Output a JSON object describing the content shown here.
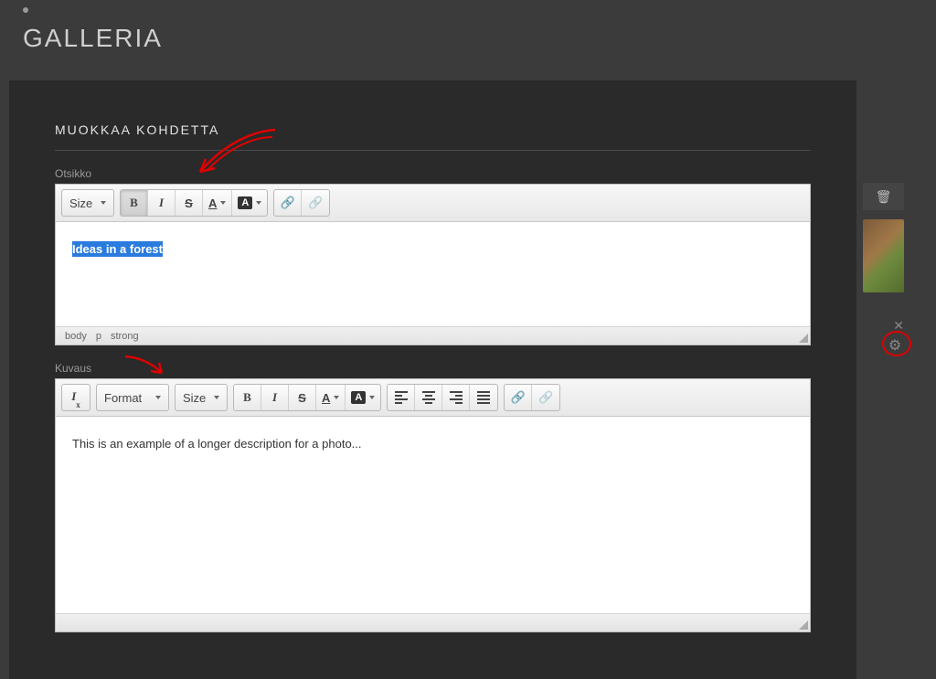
{
  "page": {
    "title": "GALLERIA"
  },
  "panel": {
    "title": "MUOKKAA KOHDETTA"
  },
  "title_field": {
    "label": "Otsikko",
    "size_label": "Size",
    "content_selected": "Ideas in a forest",
    "path": {
      "p1": "body",
      "p2": "p",
      "p3": "strong"
    }
  },
  "desc_field": {
    "label": "Kuvaus",
    "format_label": "Format",
    "size_label": "Size",
    "content": "This is an example of a longer description for a photo..."
  }
}
